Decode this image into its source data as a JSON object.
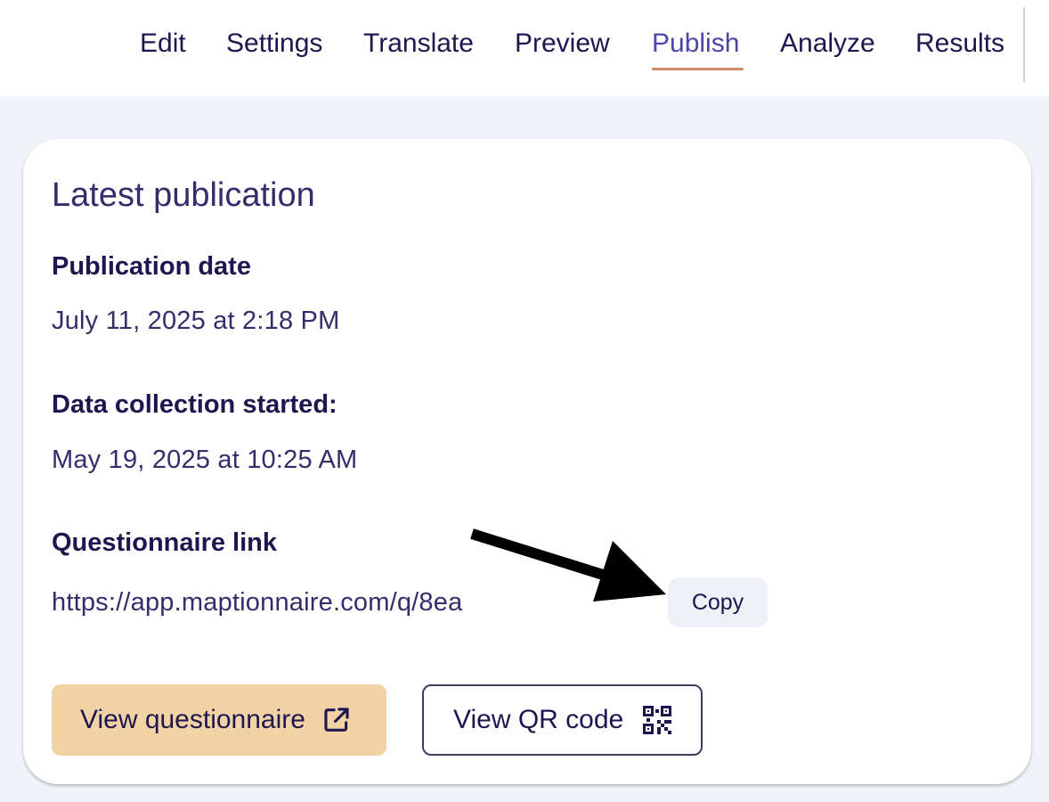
{
  "nav": {
    "tabs": [
      "Edit",
      "Settings",
      "Translate",
      "Preview",
      "Publish",
      "Analyze",
      "Results"
    ],
    "active": "Publish"
  },
  "card": {
    "title": "Latest publication",
    "publication_date_label": "Publication date",
    "publication_date_value": "July 11, 2025 at 2:18 PM",
    "data_collection_label": "Data collection started:",
    "data_collection_value": "May 19, 2025 at 10:25 AM",
    "link_label": "Questionnaire link",
    "link_value": "https://app.maptionnaire.com/q/8ea",
    "copy_label": "Copy",
    "view_questionnaire_label": "View questionnaire",
    "view_qr_label": "View QR code"
  },
  "icons": {
    "external_link": "external-link-icon",
    "qr_code": "qr-code-icon",
    "annotation_arrow": "arrow-icon"
  },
  "colors": {
    "accent_underline": "#d48a5f",
    "active_tab": "#4b47a8",
    "primary_button": "#f2d3a5",
    "text": "#1f1650"
  }
}
